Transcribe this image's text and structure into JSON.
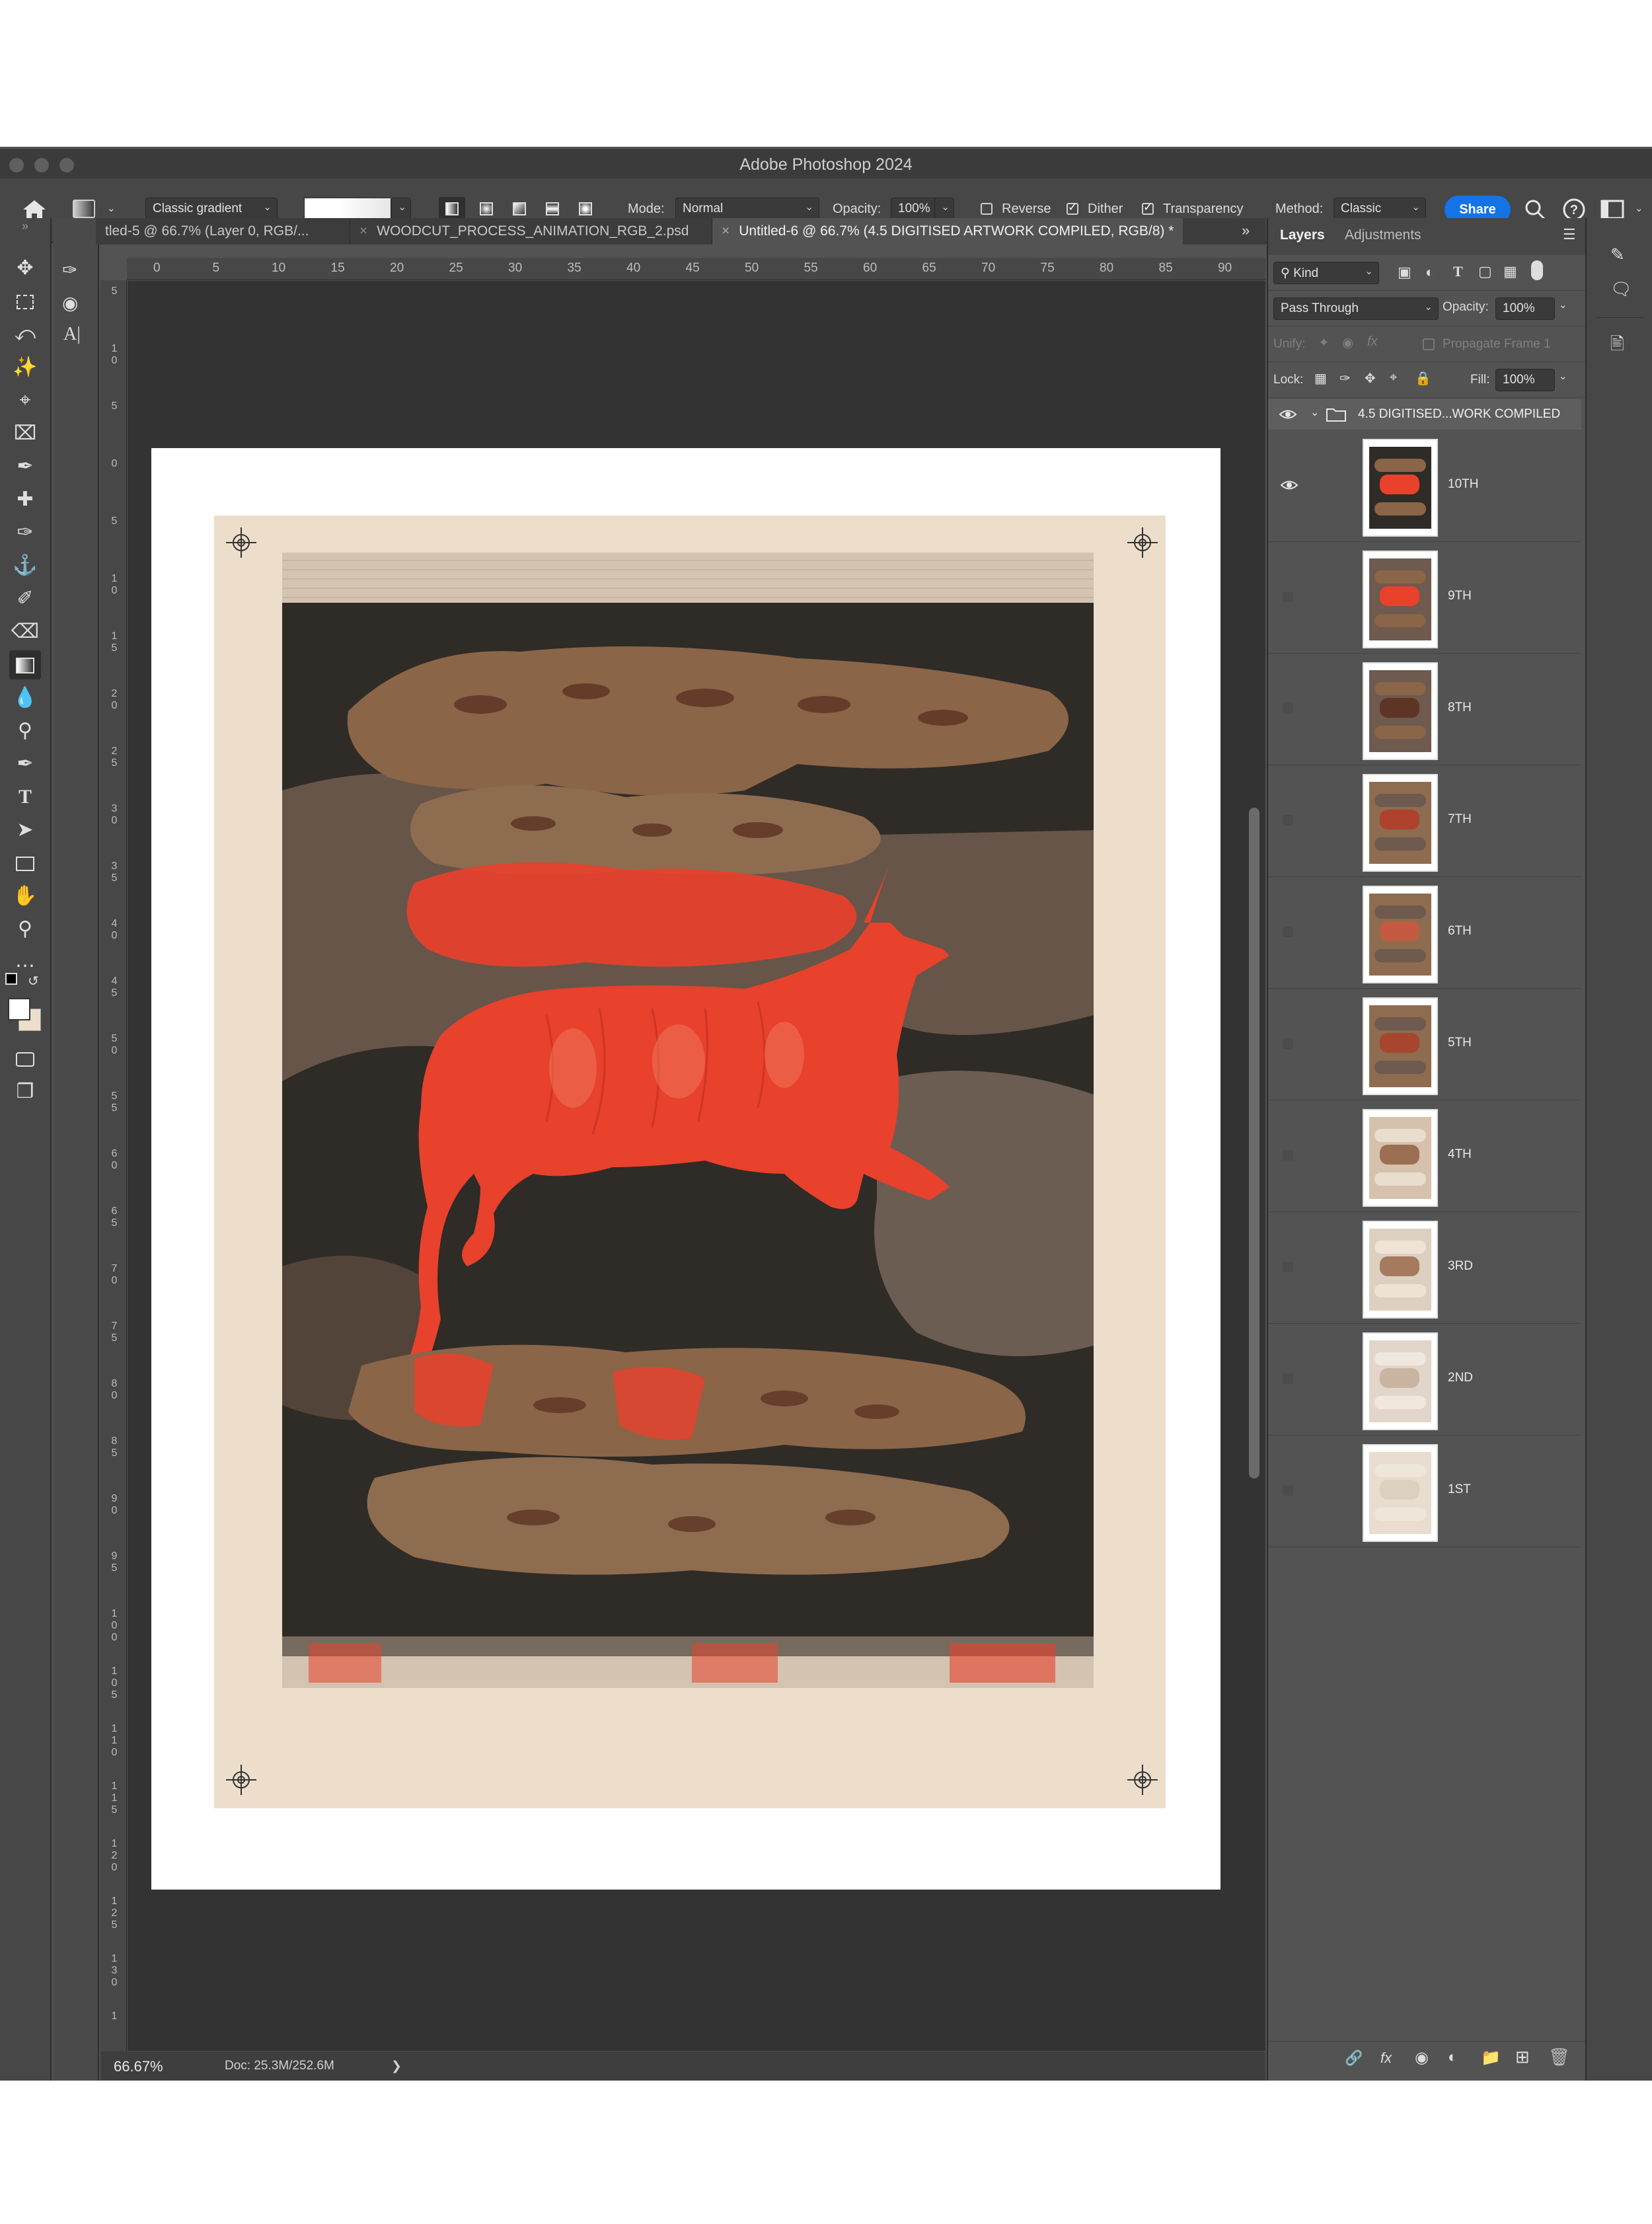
{
  "app": {
    "window_title": "Adobe Photoshop 2024"
  },
  "options_bar": {
    "gradient_style": "Classic gradient",
    "mode_label": "Mode:",
    "mode_value": "Normal",
    "opacity_label": "Opacity:",
    "opacity_value": "100%",
    "reverse_label": "Reverse",
    "reverse_checked": false,
    "dither_label": "Dither",
    "dither_checked": true,
    "transparency_label": "Transparency",
    "transparency_checked": true,
    "method_label": "Method:",
    "method_value": "Classic",
    "share_label": "Share"
  },
  "tabs": [
    {
      "label": "tled-5 @ 66.7% (Layer 0, RGB/...",
      "active": false
    },
    {
      "label": "WOODCUT_PROCESS_ANIMATION_RGB_2.psd",
      "active": false
    },
    {
      "label": "Untitled-6 @ 66.7% (4.5 DIGITISED ARTWORK COMPILED, RGB/8) *",
      "active": true
    }
  ],
  "rulers": {
    "horizontal": [
      "0",
      "5",
      "10",
      "15",
      "20",
      "25",
      "30",
      "35",
      "40",
      "45",
      "50",
      "55",
      "60",
      "65",
      "70",
      "75",
      "80",
      "85",
      "90"
    ],
    "vertical": [
      "5",
      "10",
      "5",
      "0",
      "5",
      "10",
      "15",
      "20",
      "25",
      "30",
      "35",
      "40",
      "45",
      "50",
      "55",
      "60",
      "65",
      "70",
      "75",
      "80",
      "85",
      "90",
      "95",
      "100",
      "105",
      "110",
      "115",
      "120",
      "125",
      "130",
      "1"
    ]
  },
  "status": {
    "zoom": "66.67%",
    "doc": "Doc: 25.3M/252.6M",
    "arrow": "❯"
  },
  "layers_panel": {
    "tab_layers": "Layers",
    "tab_adjustments": "Adjustments",
    "kind_label": "Kind",
    "blend_mode": "Pass Through",
    "opacity_label": "Opacity:",
    "opacity_value": "100%",
    "unify_label": "Unify:",
    "propagate_label": "Propagate Frame 1",
    "lock_label": "Lock:",
    "fill_label": "Fill:",
    "fill_value": "100%",
    "group_name": "4.5 DIGITISED...WORK COMPILED",
    "layers": [
      {
        "name": "10TH",
        "visible": true
      },
      {
        "name": "9TH",
        "visible": false
      },
      {
        "name": "8TH",
        "visible": false
      },
      {
        "name": "7TH",
        "visible": false
      },
      {
        "name": "6TH",
        "visible": false
      },
      {
        "name": "5TH",
        "visible": false
      },
      {
        "name": "4TH",
        "visible": false
      },
      {
        "name": "3RD",
        "visible": false
      },
      {
        "name": "2ND",
        "visible": false
      },
      {
        "name": "1ST",
        "visible": false
      }
    ]
  },
  "colors": {
    "accent_share": "#1473e6",
    "paper": "#ecdecb",
    "bull_red": "#e8412c"
  }
}
